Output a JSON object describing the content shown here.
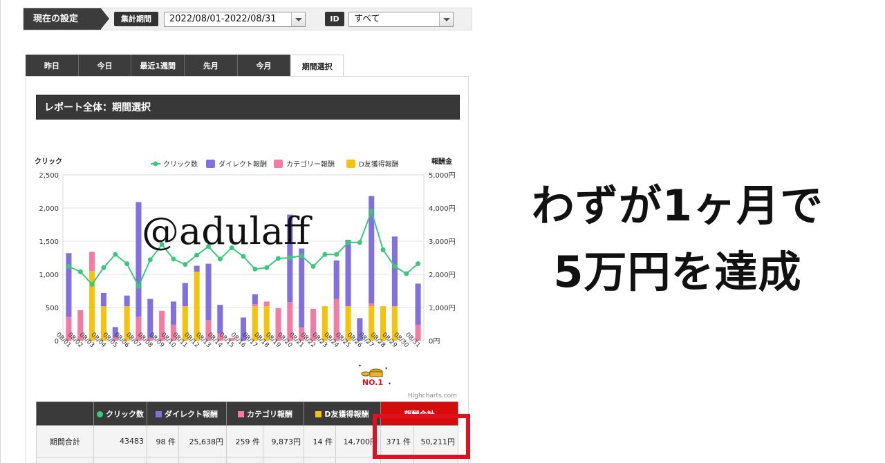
{
  "settings": {
    "label": "現在の設定",
    "period_label": "集計期間",
    "period_value": "2022/08/01-2022/08/31",
    "id_label": "ID",
    "id_value": "すべて"
  },
  "tabs": [
    {
      "label": "昨日"
    },
    {
      "label": "今日"
    },
    {
      "label": "最近1週間"
    },
    {
      "label": "先月"
    },
    {
      "label": "今月"
    },
    {
      "label": "期間選択",
      "active": true
    }
  ],
  "report": {
    "title": "レポート全体：期間選択"
  },
  "chart_data": {
    "type": "bar",
    "y_left_label": "クリック",
    "y_right_label": "報酬金",
    "y_left_ticks": [
      "2,500",
      "2,000",
      "1,500",
      "1,000",
      "500",
      "0"
    ],
    "y_right_ticks": [
      "5,000円",
      "4,000円",
      "3,000円",
      "2,000円",
      "1,000円",
      "0円"
    ],
    "ylim": [
      0,
      2500
    ],
    "categories": [
      "08/01",
      "08/02",
      "08/03",
      "08/04",
      "08/05",
      "08/06",
      "08/07",
      "08/08",
      "08/09",
      "08/10",
      "08/11",
      "08/12",
      "08/13",
      "08/14",
      "08/15",
      "08/16",
      "08/17",
      "08/18",
      "08/19",
      "08/20",
      "08/21",
      "08/22",
      "08/23",
      "08/24",
      "08/25",
      "08/26",
      "08/27",
      "08/28",
      "08/29",
      "08/30",
      "08/31"
    ],
    "legend": [
      "クリック数",
      "ダイレクト報酬",
      "カテゴリー報酬",
      "D友獲得報酬"
    ],
    "colors": {
      "click": "#3cc87a",
      "direct": "#8370e0",
      "category": "#f47ca4",
      "dfriend": "#f5c20c"
    },
    "series": [
      {
        "name": "D友獲得報酬",
        "values": [
          0,
          0,
          1050,
          520,
          0,
          520,
          0,
          0,
          0,
          0,
          520,
          1040,
          0,
          0,
          0,
          0,
          520,
          520,
          0,
          0,
          0,
          0,
          520,
          0,
          520,
          0,
          520,
          520,
          520,
          0,
          0
        ]
      },
      {
        "name": "カテゴリー報酬",
        "values": [
          360,
          460,
          290,
          0,
          45,
          0,
          360,
          40,
          450,
          240,
          0,
          0,
          310,
          110,
          40,
          0,
          30,
          70,
          490,
          580,
          200,
          480,
          0,
          630,
          0,
          0,
          40,
          0,
          0,
          0,
          240
        ]
      },
      {
        "name": "ダイレクト報酬",
        "values": [
          960,
          0,
          0,
          200,
          160,
          160,
          1730,
          590,
          0,
          350,
          350,
          90,
          850,
          430,
          0,
          350,
          150,
          0,
          0,
          1320,
          1190,
          0,
          0,
          580,
          1000,
          340,
          1620,
          0,
          1050,
          0,
          620
        ]
      },
      {
        "name": "クリック数",
        "values": [
          1120,
          1040,
          850,
          1100,
          1300,
          1160,
          820,
          1220,
          1450,
          1230,
          1150,
          1290,
          1420,
          1230,
          1400,
          1270,
          1080,
          1100,
          1240,
          1250,
          1280,
          1120,
          1300,
          1300,
          1480,
          1480,
          1950,
          1370,
          1120,
          1010,
          1160
        ]
      }
    ]
  },
  "watermark": "@adulaff",
  "credit": "Highcharts.com",
  "badge": "NO.1",
  "summary": {
    "headers": [
      "",
      "クリック数",
      "ダイレクト報酬",
      "カテゴリ報酬",
      "D友獲得報酬",
      "報酬合計"
    ],
    "row_label": "期間合計",
    "clicks": "43483",
    "direct_count": "98 件",
    "direct_amount": "25,638円",
    "category_count": "259 件",
    "category_amount": "9,873円",
    "dfriend_count": "14 件",
    "dfriend_amount": "14,700円",
    "total_count": "371 件",
    "total_amount": "50,211円"
  },
  "headline": {
    "line1": "わずが1ヶ月で",
    "line2": "5万円を達成"
  }
}
